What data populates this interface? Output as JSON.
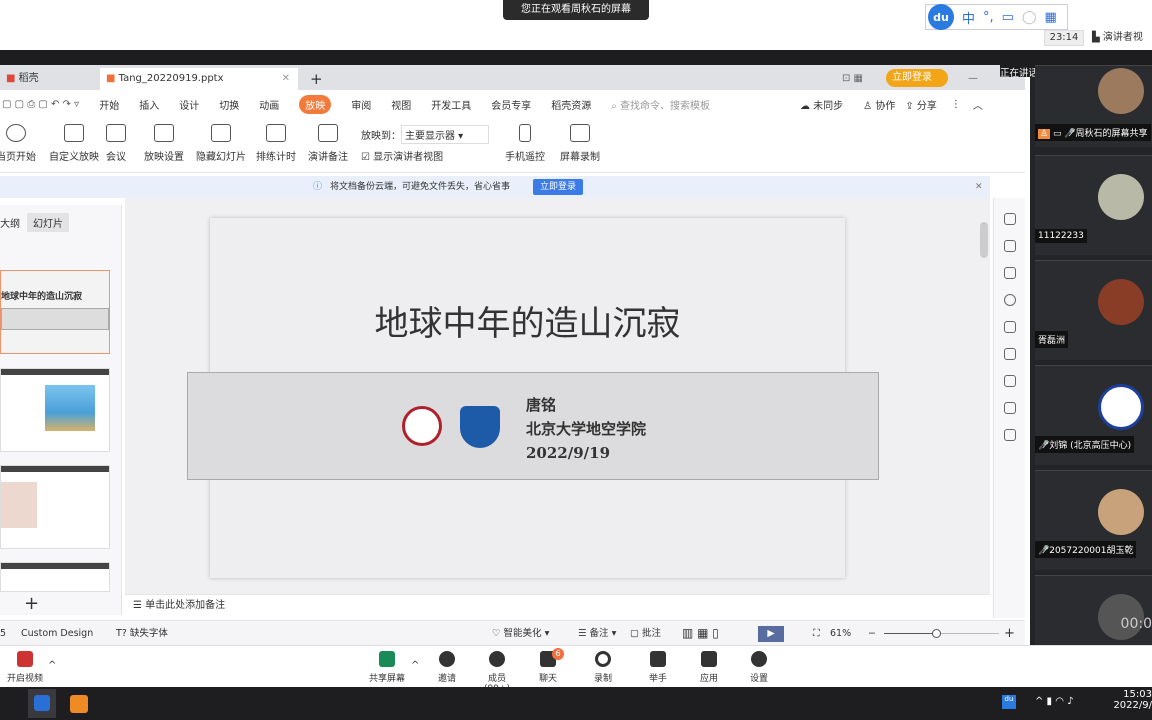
{
  "overlay": {
    "watching": "您正在观看周秋石的屏幕",
    "clock": "23:14",
    "presenter_view": "演讲者视"
  },
  "ime": {
    "logo": "du",
    "items": [
      "中",
      "°,"
    ]
  },
  "tabs": [
    {
      "label": "稻壳"
    },
    {
      "label": "Tang_20220919.pptx"
    }
  ],
  "window": {
    "login": "立即登录"
  },
  "menu": {
    "items": [
      "开始",
      "插入",
      "设计",
      "切换",
      "动画",
      "放映",
      "审阅",
      "视图",
      "开发工具",
      "会员专享",
      "稻壳资源"
    ],
    "active": "放映",
    "search_placeholder": "查找命令、搜索模板",
    "sync": "未同步",
    "collab": "协作",
    "share": "分享"
  },
  "ribbon": {
    "buttons": [
      "当页开始",
      "自定义放映",
      "会议",
      "放映设置",
      "隐藏幻灯片",
      "排练计时",
      "演讲备注",
      "手机遥控",
      "屏幕录制"
    ],
    "show_on_label": "放映到：",
    "show_on_value": "主要显示器",
    "presenter_checkbox": "显示演讲者视图",
    "presenter_checked": true
  },
  "notice": {
    "text": "将文档备份云端，可避免文件丢失，省心省事",
    "button": "立即登录"
  },
  "left_panel": {
    "tabs": [
      "大纲",
      "幻灯片"
    ],
    "thumb1_title": "地球中年的造山沉寂"
  },
  "slide": {
    "title": "地球中年的造山沉寂",
    "author": "唐铭",
    "affiliation": "北京大学地空学院",
    "date": "2022/9/19"
  },
  "notes": {
    "placeholder": "单击此处添加备注"
  },
  "status": {
    "slide_num": "5",
    "theme": "Custom Design",
    "missing_font": "缺失字体",
    "beautify": "智能美化",
    "notes": "备注",
    "comments": "批注",
    "zoom": "61%",
    "zoom_fraction": 0.45
  },
  "panel": {
    "speaking": "正在讲话:",
    "participants": [
      "周秋石的屏幕共享",
      "11122233",
      "胥磊洲",
      "刘锦 (北京高压中心)",
      "2057220001胡玉乾"
    ],
    "timer": "00:0"
  },
  "meeting": {
    "items": [
      "开启视频",
      "共享屏幕",
      "邀请",
      "成员(99+)",
      "聊天",
      "录制",
      "举手",
      "应用",
      "设置"
    ],
    "chat_badge": "6"
  },
  "taskbar": {
    "time": "15:03",
    "date": "2022/9/"
  }
}
